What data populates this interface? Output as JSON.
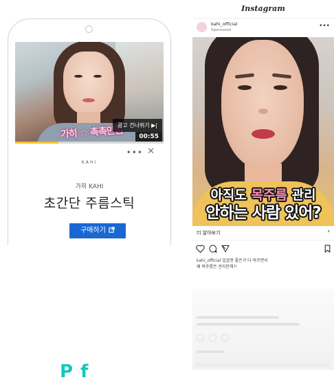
{
  "left_ad": {
    "skip_label": "광고 건너뛰기 ▶|",
    "duration": "00:55",
    "video_caption": "가히 ☆ 촉촉만점",
    "progress_fraction": 0.29,
    "more_glyph": "•••",
    "close_glyph": "✕",
    "brand_logo": "KAHI",
    "brand_name": "가히 KAHI",
    "title": "초간단 주름스틱",
    "cta_label": "구매하기",
    "cta_icon": "external-link-icon",
    "accent_color": "#1a67d2",
    "progress_color": "#f2c12e"
  },
  "instagram": {
    "app_title": "Instagram",
    "username": "kahi_official",
    "sponsored": "Sponsored",
    "more_glyph": "•••",
    "photo_caption_line1_pre": "아직도 ",
    "photo_caption_line1_hl": "목주름",
    "photo_caption_line1_post": " 관리",
    "photo_caption_line2": "안하는 사람 있어?",
    "learn_more": "더 알아보기",
    "learn_more_chevron": "›",
    "caption_line1": "kahi_official 얼굴엔 좋은거 다 바르면서",
    "caption_line2": "왜 목주름은 관리안해?!"
  },
  "bottom_label": "P f"
}
